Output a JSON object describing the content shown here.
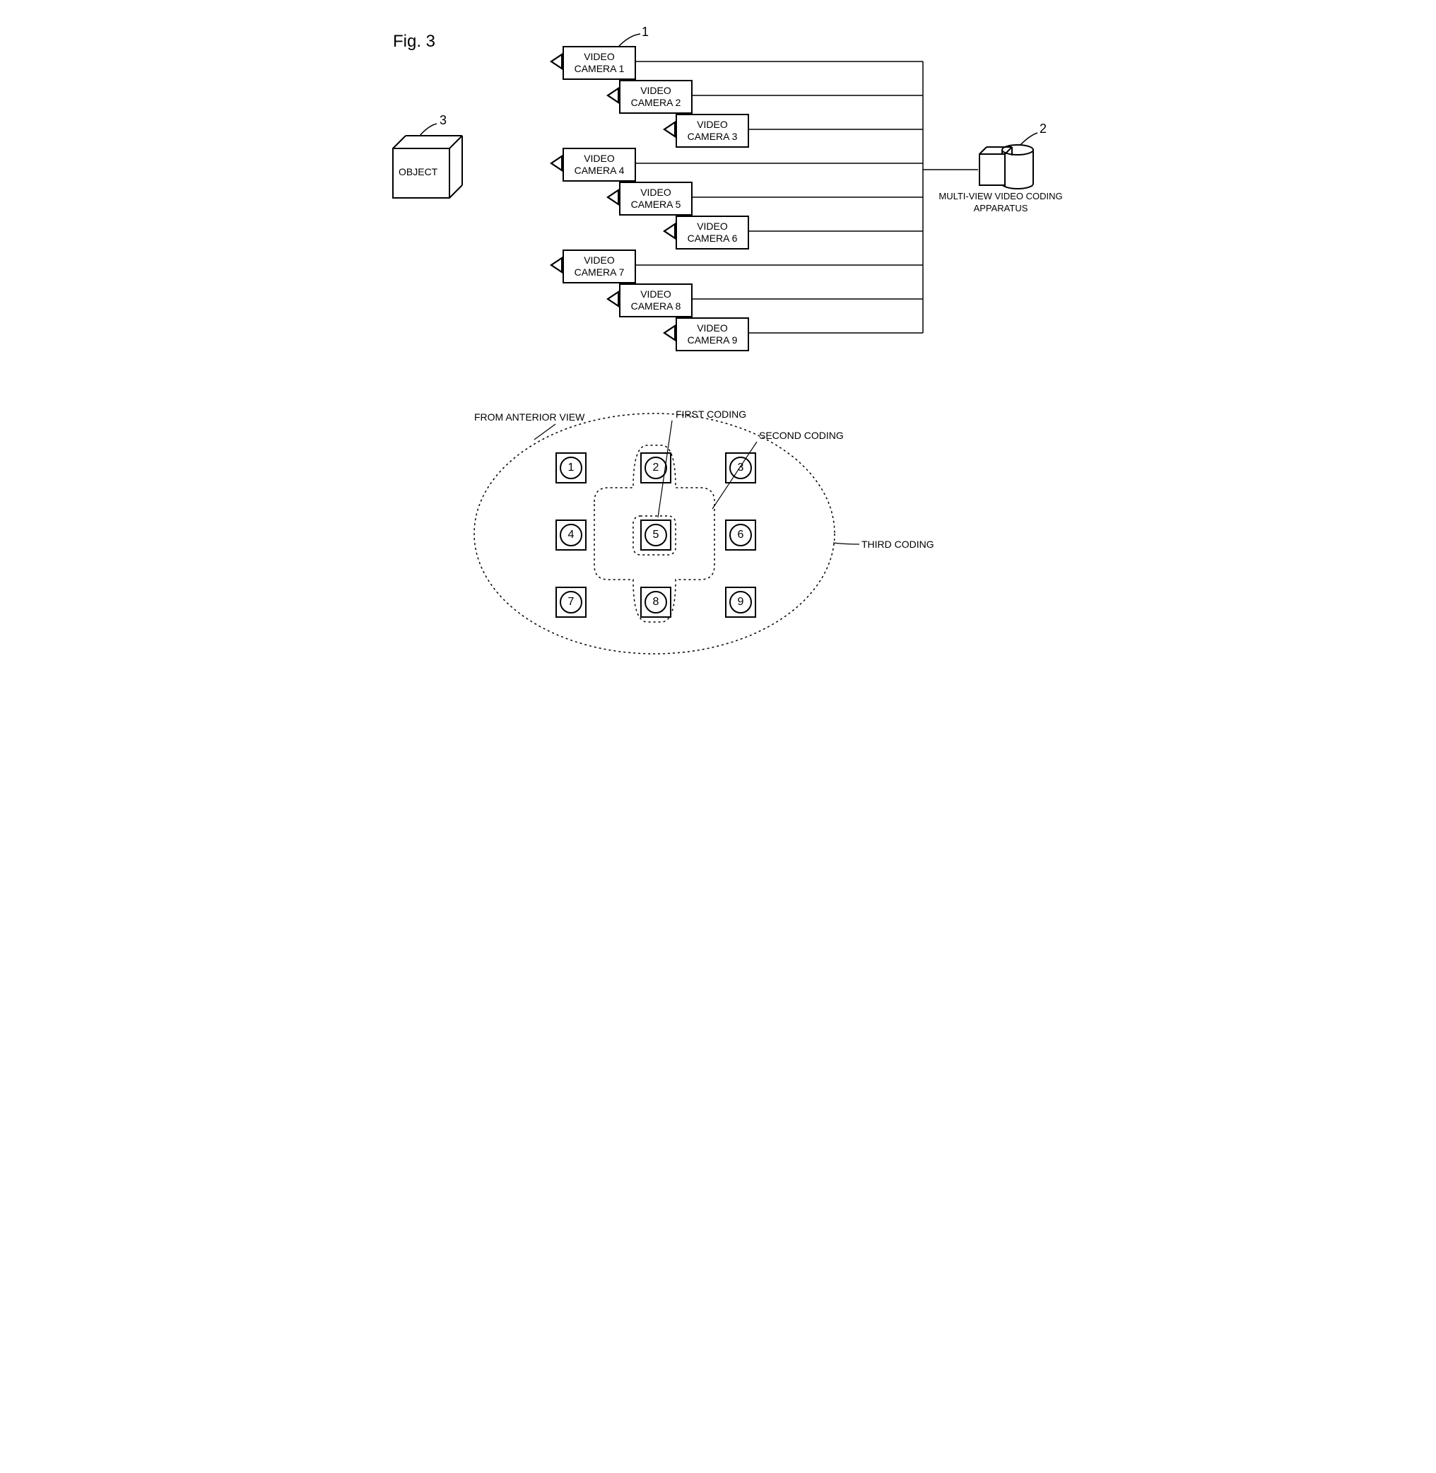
{
  "figure_label": "Fig. 3",
  "object_label": "OBJECT",
  "cameras": {
    "c1": "VIDEO\nCAMERA 1",
    "c2": "VIDEO\nCAMERA 2",
    "c3": "VIDEO\nCAMERA 3",
    "c4": "VIDEO\nCAMERA 4",
    "c5": "VIDEO\nCAMERA 5",
    "c6": "VIDEO\nCAMERA 6",
    "c7": "VIDEO\nCAMERA 7",
    "c8": "VIDEO\nCAMERA 8",
    "c9": "VIDEO\nCAMERA 9"
  },
  "apparatus_label": "MULTI-VIEW VIDEO CODING\nAPPARATUS",
  "ref_numbers": {
    "camera1": "1",
    "apparatus": "2",
    "object": "3"
  },
  "bottom": {
    "anterior": "FROM ANTERIOR VIEW",
    "first": "FIRST CODING",
    "second": "SECOND CODING",
    "third": "THIRD CODING",
    "n1": "1",
    "n2": "2",
    "n3": "3",
    "n4": "4",
    "n5": "5",
    "n6": "6",
    "n7": "7",
    "n8": "8",
    "n9": "9"
  }
}
